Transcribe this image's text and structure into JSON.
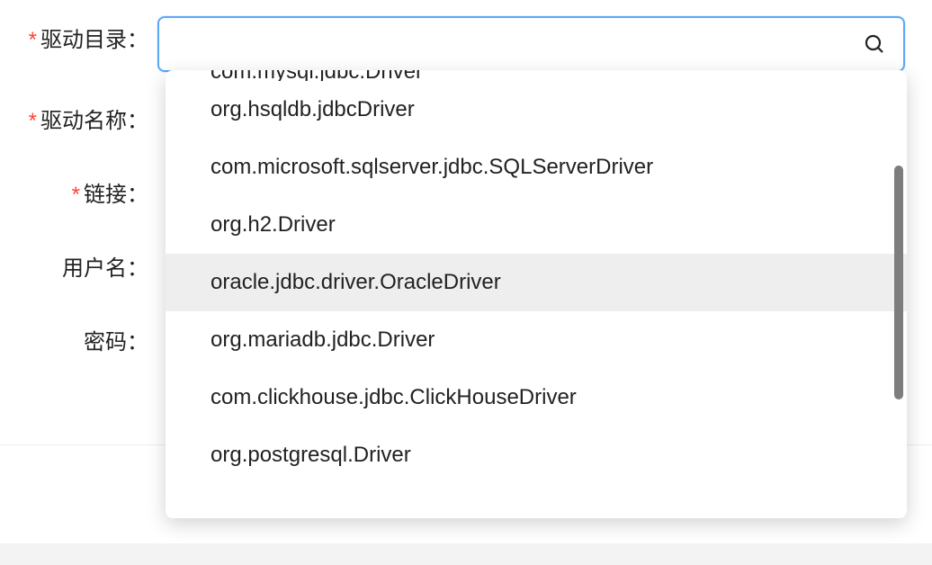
{
  "form": {
    "driver_dir": {
      "label": "驱动目录：",
      "required": true,
      "value": ""
    },
    "driver_name": {
      "label": "驱动名称：",
      "required": true
    },
    "link": {
      "label": "链接：",
      "required": true
    },
    "username": {
      "label": "用户名：",
      "required": false
    },
    "password": {
      "label": "密码：",
      "required": false
    }
  },
  "dropdown": {
    "highlighted_index": 4,
    "options": [
      "com.mysql.jdbc.Driver",
      "org.hsqldb.jdbcDriver",
      "com.microsoft.sqlserver.jdbc.SQLServerDriver",
      "org.h2.Driver",
      "oracle.jdbc.driver.OracleDriver",
      "org.mariadb.jdbc.Driver",
      "com.clickhouse.jdbc.ClickHouseDriver",
      "org.postgresql.Driver"
    ]
  }
}
